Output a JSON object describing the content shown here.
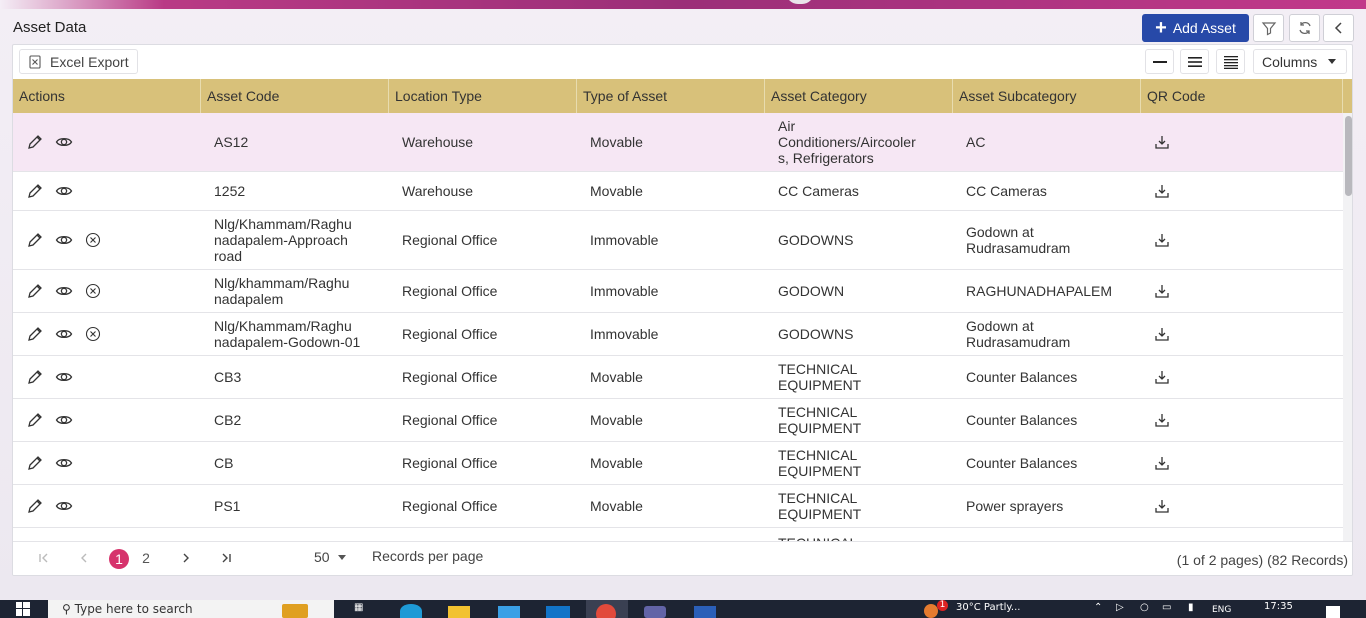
{
  "page": {
    "title": "Asset Data"
  },
  "header": {
    "add_label": "Add Asset"
  },
  "toolbar": {
    "excel_label": "Excel Export",
    "columns_label": "Columns"
  },
  "table": {
    "columns": [
      "Actions",
      "Asset Code",
      "Location Type",
      "Type of Asset",
      "Asset Category",
      "Asset Subcategory",
      "QR Code"
    ],
    "rows": [
      {
        "code": [
          "AS12"
        ],
        "location": "Warehouse",
        "type": "Movable",
        "category": [
          "Air",
          "Conditioners/Aircooler",
          "s, Refrigerators"
        ],
        "subcategory": [
          "AC"
        ],
        "delete": false,
        "selected": true
      },
      {
        "code": [
          "1252"
        ],
        "location": "Warehouse",
        "type": "Movable",
        "category": [
          "CC Cameras"
        ],
        "subcategory": [
          "CC Cameras"
        ],
        "delete": false,
        "selected": false
      },
      {
        "code": [
          "Nlg/Khammam/Raghu",
          "nadapalem-Approach",
          "road"
        ],
        "location": "Regional Office",
        "type": "Immovable",
        "category": [
          "GODOWNS"
        ],
        "subcategory": [
          "Godown at",
          "Rudrasamudram"
        ],
        "delete": true,
        "selected": false
      },
      {
        "code": [
          "Nlg/khammam/Raghu",
          "nadapalem"
        ],
        "location": "Regional Office",
        "type": "Immovable",
        "category": [
          "GODOWN"
        ],
        "subcategory": [
          "RAGHUNADHAPALEM"
        ],
        "delete": true,
        "selected": false
      },
      {
        "code": [
          "Nlg/Khammam/Raghu",
          "nadapalem-Godown-01"
        ],
        "location": "Regional Office",
        "type": "Immovable",
        "category": [
          "GODOWNS"
        ],
        "subcategory": [
          "Godown at",
          "Rudrasamudram"
        ],
        "delete": true,
        "selected": false
      },
      {
        "code": [
          "CB3"
        ],
        "location": "Regional Office",
        "type": "Movable",
        "category": [
          "TECHNICAL",
          "EQUIPMENT"
        ],
        "subcategory": [
          "Counter Balances"
        ],
        "delete": false,
        "selected": false
      },
      {
        "code": [
          "CB2"
        ],
        "location": "Regional Office",
        "type": "Movable",
        "category": [
          "TECHNICAL",
          "EQUIPMENT"
        ],
        "subcategory": [
          "Counter Balances"
        ],
        "delete": false,
        "selected": false
      },
      {
        "code": [
          "CB"
        ],
        "location": "Regional Office",
        "type": "Movable",
        "category": [
          "TECHNICAL",
          "EQUIPMENT"
        ],
        "subcategory": [
          "Counter Balances"
        ],
        "delete": false,
        "selected": false
      },
      {
        "code": [
          "PS1"
        ],
        "location": "Regional Office",
        "type": "Movable",
        "category": [
          "TECHNICAL",
          "EQUIPMENT"
        ],
        "subcategory": [
          "Power sprayers"
        ],
        "delete": false,
        "selected": false
      },
      {
        "code": [
          ""
        ],
        "location": "",
        "type": "",
        "category": [
          "TECHNICAL"
        ],
        "subcategory": [
          ""
        ],
        "delete": false,
        "selected": false
      }
    ]
  },
  "pagination": {
    "pages": [
      "1",
      "2"
    ],
    "current": "1",
    "per_page": "50",
    "per_page_label": "Records per page",
    "info": "(1 of 2 pages) (82 Records)"
  },
  "taskbar": {
    "search": "Type here to search",
    "weather": "30°C  Partly...",
    "lang": "ENG",
    "time": "17:35",
    "notif_count": "1"
  },
  "colors": {
    "accent": "#2749a8",
    "header": "#d8c17a",
    "selected_row": "#f6e7f4",
    "active_page": "#d6336c"
  }
}
